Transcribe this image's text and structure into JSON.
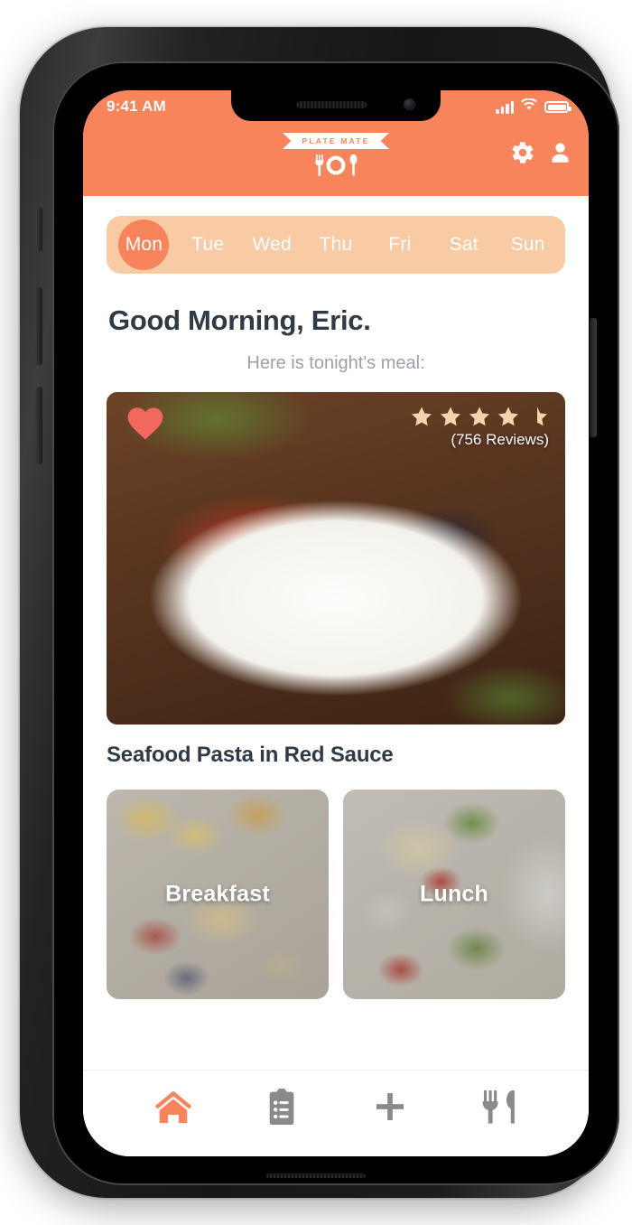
{
  "device": {
    "status_bar": {
      "time": "9:41 AM",
      "signal_icon": "cellular-signal-icon",
      "wifi_icon": "wifi-icon",
      "battery_icon": "battery-full-icon"
    },
    "buttons": {
      "mute_switch": "mute-switch",
      "volume_up": "volume-up-button",
      "volume_down": "volume-down-button",
      "power": "power-button"
    }
  },
  "appbar": {
    "brand_name": "PLATE MATE",
    "brand_icon": "fork-plate-spoon-icon",
    "settings_icon": "gear-icon",
    "profile_icon": "person-icon",
    "background_color": "#F8845C"
  },
  "day_selector": {
    "background_color": "#F8CBA5",
    "active_color": "#F8845C",
    "selected": "Mon",
    "days": [
      {
        "label": "Mon",
        "active": true
      },
      {
        "label": "Tue",
        "active": false
      },
      {
        "label": "Wed",
        "active": false
      },
      {
        "label": "Thu",
        "active": false
      },
      {
        "label": "Fri",
        "active": false
      },
      {
        "label": "Sat",
        "active": false
      },
      {
        "label": "Sun",
        "active": false
      }
    ]
  },
  "main": {
    "greeting": "Good Morning, Eric.",
    "subgreeting": "Here is tonight's meal:",
    "hero": {
      "favorite_icon": "heart-icon",
      "favorite_color": "#F2685F",
      "rating": 4.5,
      "stars_total": 5,
      "star_color": "#F7D2AE",
      "review_count_label": "(756 Reviews)",
      "dish_title": "Seafood Pasta in Red Sauce",
      "image_alt": "seafood-pasta-photo"
    },
    "meal_cards": [
      {
        "label": "Breakfast",
        "image_alt": "breakfast-spread-photo"
      },
      {
        "label": "Lunch",
        "image_alt": "lunch-salad-photo"
      }
    ]
  },
  "bottom_nav": {
    "active_color": "#F8845C",
    "inactive_color": "#8A8A8A",
    "items": [
      {
        "name": "home-icon",
        "active": true
      },
      {
        "name": "clipboard-list-icon",
        "active": false
      },
      {
        "name": "plus-icon",
        "active": false
      },
      {
        "name": "fork-knife-icon",
        "active": false
      }
    ]
  }
}
